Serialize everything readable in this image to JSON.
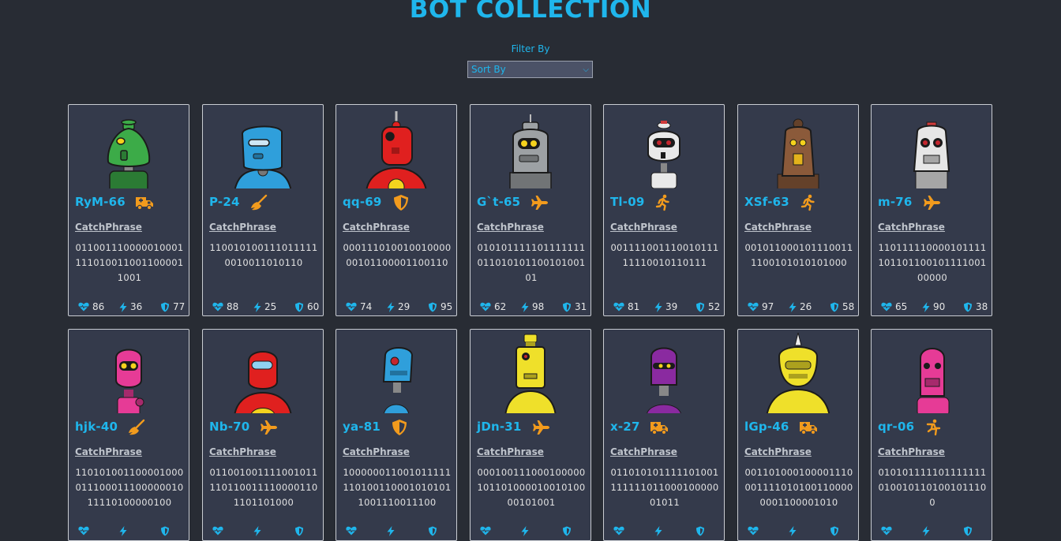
{
  "header": {
    "title": "BOT COLLECTION"
  },
  "filter": {
    "label": "Filter By",
    "select_value": "Sort By"
  },
  "card_label": "CatchPhrase",
  "colors": {
    "accent": "#1fb6ec",
    "class_icon": "#f29b1d",
    "background": "#282c34",
    "card": "#343a4b"
  },
  "bots": [
    {
      "name": "RyM-66",
      "class_icon": "ambulance-icon",
      "catchphrase": "0110011100000100011110100110011000011001",
      "health": "86",
      "damage": "36",
      "armor": "77",
      "robot_color": "#3cab48"
    },
    {
      "name": "P-24",
      "class_icon": "broom-icon",
      "catchphrase": "1100101001110111110010011010110",
      "health": "88",
      "damage": "25",
      "armor": "60",
      "robot_color": "#2f9fdb"
    },
    {
      "name": "qq-69",
      "class_icon": "shield-icon",
      "catchphrase": "00011101001001000000101100001100110",
      "health": "74",
      "damage": "29",
      "armor": "95",
      "robot_color": "#e0201f"
    },
    {
      "name": "G`t-65",
      "class_icon": "plane-icon",
      "catchphrase": "01010111110111111101101010110010100101",
      "health": "62",
      "damage": "98",
      "armor": "31",
      "robot_color": "#9da1a4"
    },
    {
      "name": "Tl-09",
      "class_icon": "runner-icon",
      "catchphrase": "00111100111001011111110010110111",
      "health": "81",
      "damage": "39",
      "armor": "52",
      "robot_color": "#e9e9e9"
    },
    {
      "name": "XSf-63",
      "class_icon": "runner-icon",
      "catchphrase": "0010110001011100111100101010101000",
      "health": "97",
      "damage": "26",
      "armor": "58",
      "robot_color": "#8b5a3a"
    },
    {
      "name": "m-76",
      "class_icon": "plane-icon",
      "catchphrase": "11011111000010111110110110010111100100000",
      "health": "65",
      "damage": "90",
      "armor": "38",
      "robot_color": "#e6e6e6"
    },
    {
      "name": "hjk-40",
      "class_icon": "broom-icon",
      "catchphrase": "11010100110000100001110001110000001011110100000100",
      "health": "",
      "damage": "",
      "armor": "",
      "robot_color": "#e63b96"
    },
    {
      "name": "Nb-70",
      "class_icon": "plane-icon",
      "catchphrase": "0110010011110010111101100111100001101101101000",
      "health": "",
      "damage": "",
      "armor": "",
      "robot_color": "#e0201f"
    },
    {
      "name": "ya-81",
      "class_icon": "shield-icon",
      "catchphrase": "1000000110010111111101001100010101011001110011100",
      "health": "",
      "damage": "",
      "armor": "",
      "robot_color": "#2f9fdb"
    },
    {
      "name": "jDn-31",
      "class_icon": "plane-icon",
      "catchphrase": "00010011100010000010110100001001010000101001",
      "health": "",
      "damage": "",
      "armor": "",
      "robot_color": "#efe02a"
    },
    {
      "name": "x-27",
      "class_icon": "ambulance-icon",
      "catchphrase": "01101010111110100111111101100010000001011",
      "health": "",
      "damage": "",
      "armor": "",
      "robot_color": "#8a2aa0"
    },
    {
      "name": "lGp-46",
      "class_icon": "ambulance-icon",
      "catchphrase": "0011010001000011100011110101001100000001100001010",
      "health": "",
      "damage": "",
      "armor": "",
      "robot_color": "#efe02a"
    },
    {
      "name": "qr-06",
      "class_icon": "person-walking-icon",
      "catchphrase": "0101011111011111110100101101001011100",
      "health": "",
      "damage": "",
      "armor": "",
      "robot_color": "#e63b96"
    }
  ]
}
